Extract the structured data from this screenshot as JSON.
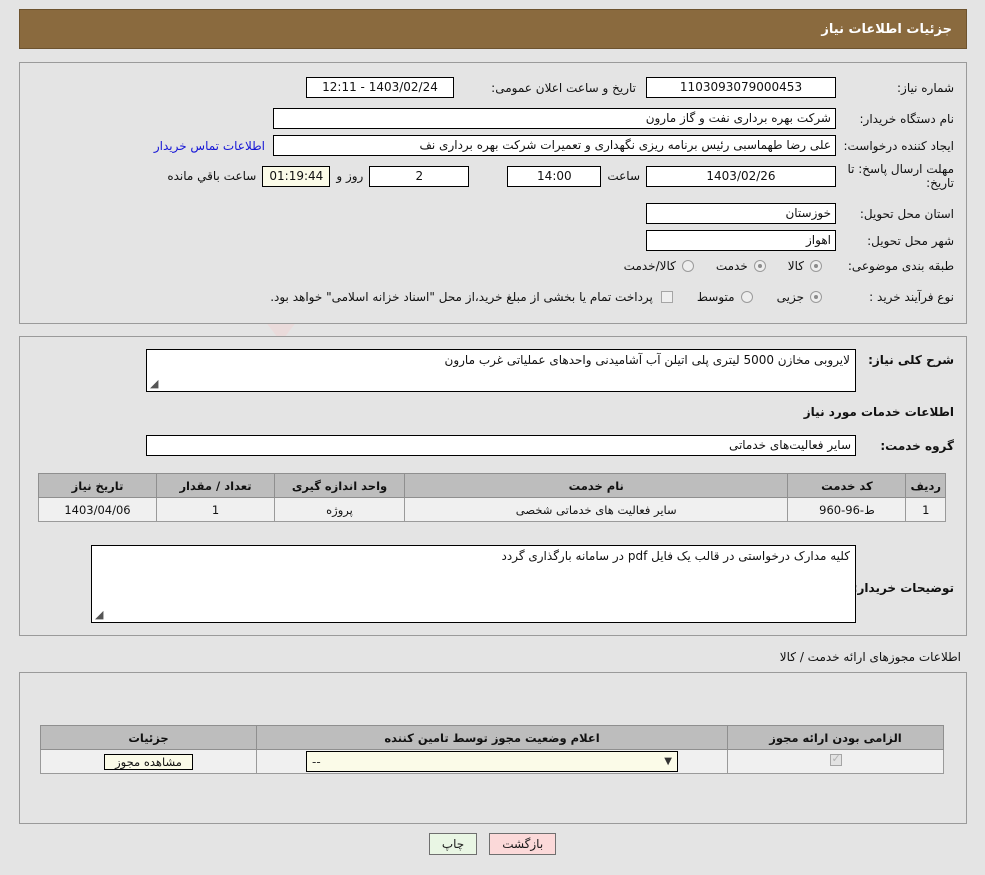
{
  "header": {
    "title": "جزئیات اطلاعات نیاز"
  },
  "watermark": {
    "text": "AriaTender.net"
  },
  "top": {
    "need_number_label": "شماره نیاز:",
    "need_number_value": "1103093079000453",
    "announce_datetime_label": "تاریخ و ساعت اعلان عمومی:",
    "announce_datetime_value": "1403/02/24 - 12:11",
    "buyer_org_label": "نام دستگاه خریدار:",
    "buyer_org_value": "شرکت بهره برداری نفت و گاز مارون",
    "creator_label": "ایجاد کننده درخواست:",
    "creator_value": "علی رضا طهماسبی رئیس برنامه ریزی نگهداری و تعمیرات شرکت بهره برداری نف",
    "contact_link": "اطلاعات تماس خریدار",
    "deadline_label": "مهلت ارسال پاسخ: تا تاریخ:",
    "deadline_date": "1403/02/26",
    "deadline_hour_label": "ساعت",
    "deadline_hour": "14:00",
    "remaining_days": "2",
    "remaining_days_label": "روز و",
    "remaining_time": "01:19:44",
    "remaining_time_label": "ساعت باقي مانده",
    "province_label": "استان محل تحویل:",
    "province_value": "خوزستان",
    "city_label": "شهر محل تحویل:",
    "city_value": "اهواز",
    "category_label": "طبقه بندی موضوعی:",
    "category_options": [
      {
        "label": "کالا",
        "selected": false
      },
      {
        "label": "خدمت",
        "selected": true
      },
      {
        "label": "کالا/خدمت",
        "selected": false
      }
    ],
    "process_label": "نوع فرآیند خرید :",
    "process_options": [
      {
        "label": "جزیی",
        "selected": true
      },
      {
        "label": "متوسط",
        "selected": false
      }
    ],
    "treasury_checkbox_checked": false,
    "treasury_note": "پرداخت تمام یا بخشی از مبلغ خرید،از محل \"اسناد خزانه اسلامی\" خواهد بود."
  },
  "mid": {
    "general_desc_label": "شرح کلی نیاز:",
    "general_desc_value": "لایروبی مخازن 5000 لیتری پلی اتیلن آب آشامیدنی واحدهای عملیاتی غرب مارون",
    "services_info_title": "اطلاعات خدمات مورد نیاز",
    "service_group_label": "گروه خدمت:",
    "service_group_value": "سایر فعالیت‌های خدماتی",
    "table": {
      "columns": [
        "ردیف",
        "کد خدمت",
        "نام خدمت",
        "واحد اندازه گیری",
        "تعداد / مقدار",
        "تاریخ نیاز"
      ],
      "rows": [
        [
          "1",
          "ط-96-960",
          "سایر فعالیت های خدماتی شخصی",
          "پروژه",
          "1",
          "1403/04/06"
        ]
      ]
    },
    "buyer_notes_label": "توضیحات خریدار:",
    "buyer_notes_value": "کلیه مدارک درخواستی در قالب یک فایل pdf در سامانه بارگذاری گردد"
  },
  "licenses": {
    "section_title": "اطلاعات مجوزهای ارائه خدمت / کالا",
    "columns": [
      "الزامی بودن ارائه مجوز",
      "اعلام وضعیت مجوز توسط تامین کننده",
      "جزئیات"
    ],
    "rows": [
      {
        "required_checked": true,
        "status_value": "--",
        "details_button": "مشاهده مجوز"
      }
    ]
  },
  "footer": {
    "print_label": "چاپ",
    "back_label": "بازگشت"
  }
}
